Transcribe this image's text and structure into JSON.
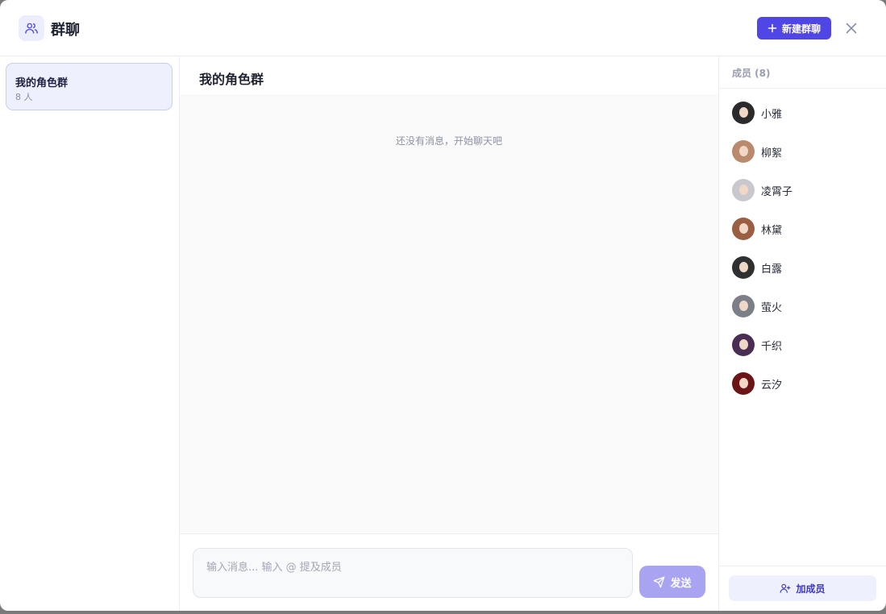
{
  "header": {
    "title": "群聊",
    "new_group_label": "新建群聊"
  },
  "groups": [
    {
      "name": "我的角色群",
      "count": "8 人"
    }
  ],
  "chat": {
    "title": "我的角色群",
    "empty_text": "还没有消息，开始聊天吧",
    "input_placeholder": "输入消息... 输入 @ 提及成员",
    "send_label": "发送"
  },
  "members": {
    "title": "成员 (8)",
    "list": [
      {
        "name": "小雅",
        "hair_color": "#2b2b2e"
      },
      {
        "name": "柳絮",
        "hair_color": "#b98a6e"
      },
      {
        "name": "凌霄子",
        "hair_color": "#c9c9cd"
      },
      {
        "name": "林黛",
        "hair_color": "#9a5f42"
      },
      {
        "name": "白露",
        "hair_color": "#2f3032"
      },
      {
        "name": "萤火",
        "hair_color": "#7d7f88"
      },
      {
        "name": "千织",
        "hair_color": "#4a2d52"
      },
      {
        "name": "云汐",
        "hair_color": "#6b1518"
      }
    ],
    "add_label": "加成员"
  },
  "colors": {
    "accent": "#4f46e5",
    "send_disabled": "#a8a4f2",
    "selected_bg": "#eef0fd"
  }
}
